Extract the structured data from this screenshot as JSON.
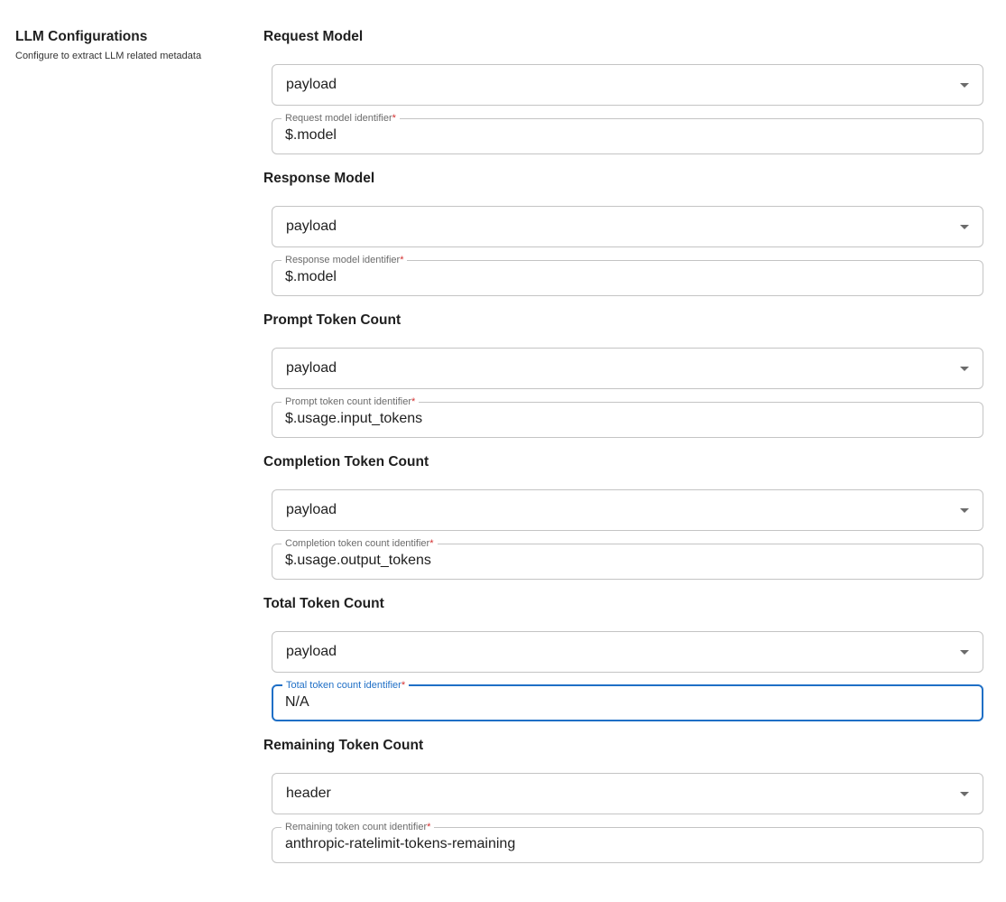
{
  "sidebar": {
    "title": "LLM Configurations",
    "subtitle": "Configure to extract LLM related metadata"
  },
  "sections": [
    {
      "title": "Request Model",
      "source": "payload",
      "identifier_label": "Request model identifier",
      "identifier_value": "$.model"
    },
    {
      "title": "Response Model",
      "source": "payload",
      "identifier_label": "Response model identifier",
      "identifier_value": "$.model"
    },
    {
      "title": "Prompt Token Count",
      "source": "payload",
      "identifier_label": "Prompt token count identifier",
      "identifier_value": "$.usage.input_tokens"
    },
    {
      "title": "Completion Token Count",
      "source": "payload",
      "identifier_label": "Completion token count identifier",
      "identifier_value": "$.usage.output_tokens"
    },
    {
      "title": "Total Token Count",
      "source": "payload",
      "identifier_label": "Total token count identifier",
      "identifier_value": "N/A"
    },
    {
      "title": "Remaining Token Count",
      "source": "header",
      "identifier_label": "Remaining token count identifier",
      "identifier_value": "anthropic-ratelimit-tokens-remaining"
    }
  ],
  "required_marker": "*",
  "colors": {
    "focus": "#1f6fc6",
    "required": "#d32f2f",
    "border": "#c4c4c4"
  },
  "icons": {
    "dropdown": "caret-down-icon"
  }
}
